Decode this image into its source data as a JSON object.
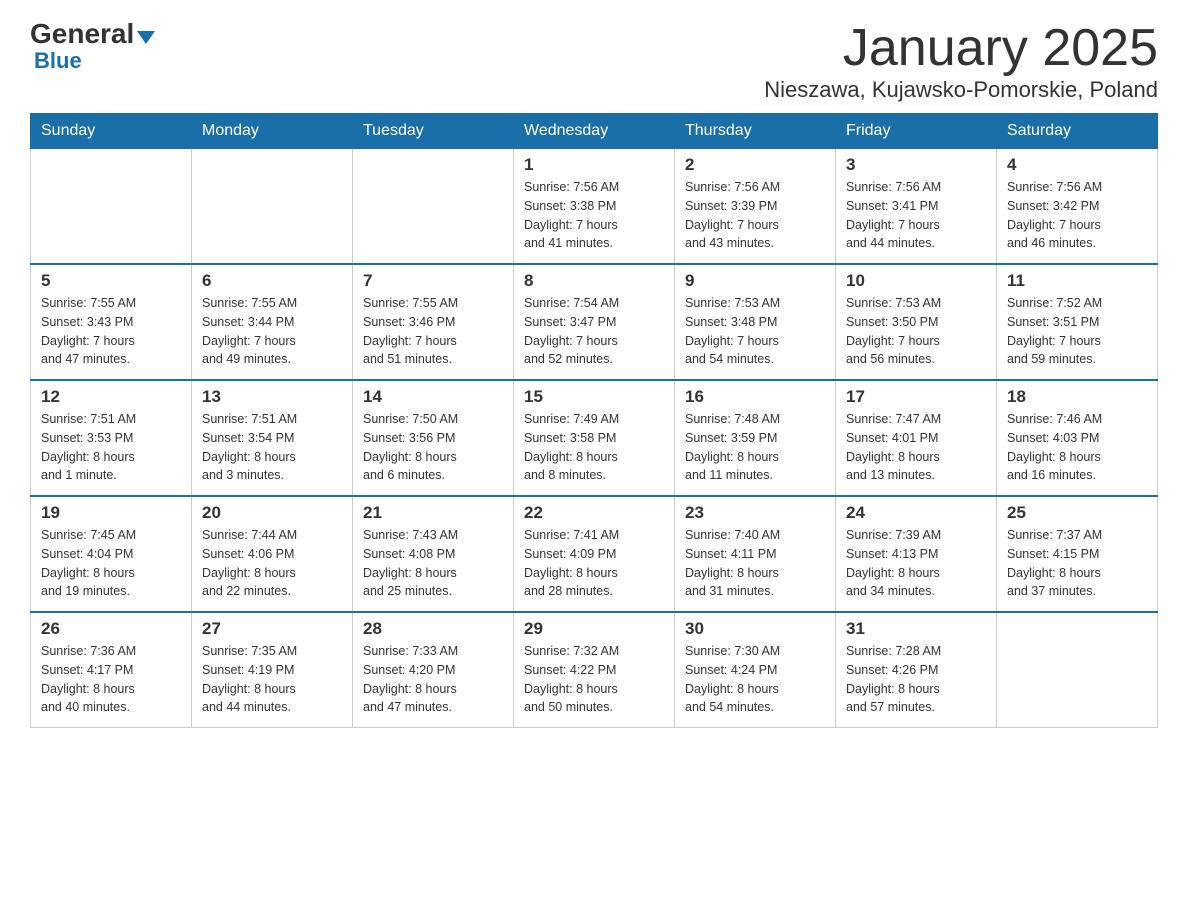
{
  "logo": {
    "general": "General",
    "arrow": "▲",
    "blue": "Blue"
  },
  "header": {
    "month_year": "January 2025",
    "location": "Nieszawa, Kujawsko-Pomorskie, Poland"
  },
  "weekdays": [
    "Sunday",
    "Monday",
    "Tuesday",
    "Wednesday",
    "Thursday",
    "Friday",
    "Saturday"
  ],
  "weeks": [
    [
      {
        "day": "",
        "info": ""
      },
      {
        "day": "",
        "info": ""
      },
      {
        "day": "",
        "info": ""
      },
      {
        "day": "1",
        "info": "Sunrise: 7:56 AM\nSunset: 3:38 PM\nDaylight: 7 hours\nand 41 minutes."
      },
      {
        "day": "2",
        "info": "Sunrise: 7:56 AM\nSunset: 3:39 PM\nDaylight: 7 hours\nand 43 minutes."
      },
      {
        "day": "3",
        "info": "Sunrise: 7:56 AM\nSunset: 3:41 PM\nDaylight: 7 hours\nand 44 minutes."
      },
      {
        "day": "4",
        "info": "Sunrise: 7:56 AM\nSunset: 3:42 PM\nDaylight: 7 hours\nand 46 minutes."
      }
    ],
    [
      {
        "day": "5",
        "info": "Sunrise: 7:55 AM\nSunset: 3:43 PM\nDaylight: 7 hours\nand 47 minutes."
      },
      {
        "day": "6",
        "info": "Sunrise: 7:55 AM\nSunset: 3:44 PM\nDaylight: 7 hours\nand 49 minutes."
      },
      {
        "day": "7",
        "info": "Sunrise: 7:55 AM\nSunset: 3:46 PM\nDaylight: 7 hours\nand 51 minutes."
      },
      {
        "day": "8",
        "info": "Sunrise: 7:54 AM\nSunset: 3:47 PM\nDaylight: 7 hours\nand 52 minutes."
      },
      {
        "day": "9",
        "info": "Sunrise: 7:53 AM\nSunset: 3:48 PM\nDaylight: 7 hours\nand 54 minutes."
      },
      {
        "day": "10",
        "info": "Sunrise: 7:53 AM\nSunset: 3:50 PM\nDaylight: 7 hours\nand 56 minutes."
      },
      {
        "day": "11",
        "info": "Sunrise: 7:52 AM\nSunset: 3:51 PM\nDaylight: 7 hours\nand 59 minutes."
      }
    ],
    [
      {
        "day": "12",
        "info": "Sunrise: 7:51 AM\nSunset: 3:53 PM\nDaylight: 8 hours\nand 1 minute."
      },
      {
        "day": "13",
        "info": "Sunrise: 7:51 AM\nSunset: 3:54 PM\nDaylight: 8 hours\nand 3 minutes."
      },
      {
        "day": "14",
        "info": "Sunrise: 7:50 AM\nSunset: 3:56 PM\nDaylight: 8 hours\nand 6 minutes."
      },
      {
        "day": "15",
        "info": "Sunrise: 7:49 AM\nSunset: 3:58 PM\nDaylight: 8 hours\nand 8 minutes."
      },
      {
        "day": "16",
        "info": "Sunrise: 7:48 AM\nSunset: 3:59 PM\nDaylight: 8 hours\nand 11 minutes."
      },
      {
        "day": "17",
        "info": "Sunrise: 7:47 AM\nSunset: 4:01 PM\nDaylight: 8 hours\nand 13 minutes."
      },
      {
        "day": "18",
        "info": "Sunrise: 7:46 AM\nSunset: 4:03 PM\nDaylight: 8 hours\nand 16 minutes."
      }
    ],
    [
      {
        "day": "19",
        "info": "Sunrise: 7:45 AM\nSunset: 4:04 PM\nDaylight: 8 hours\nand 19 minutes."
      },
      {
        "day": "20",
        "info": "Sunrise: 7:44 AM\nSunset: 4:06 PM\nDaylight: 8 hours\nand 22 minutes."
      },
      {
        "day": "21",
        "info": "Sunrise: 7:43 AM\nSunset: 4:08 PM\nDaylight: 8 hours\nand 25 minutes."
      },
      {
        "day": "22",
        "info": "Sunrise: 7:41 AM\nSunset: 4:09 PM\nDaylight: 8 hours\nand 28 minutes."
      },
      {
        "day": "23",
        "info": "Sunrise: 7:40 AM\nSunset: 4:11 PM\nDaylight: 8 hours\nand 31 minutes."
      },
      {
        "day": "24",
        "info": "Sunrise: 7:39 AM\nSunset: 4:13 PM\nDaylight: 8 hours\nand 34 minutes."
      },
      {
        "day": "25",
        "info": "Sunrise: 7:37 AM\nSunset: 4:15 PM\nDaylight: 8 hours\nand 37 minutes."
      }
    ],
    [
      {
        "day": "26",
        "info": "Sunrise: 7:36 AM\nSunset: 4:17 PM\nDaylight: 8 hours\nand 40 minutes."
      },
      {
        "day": "27",
        "info": "Sunrise: 7:35 AM\nSunset: 4:19 PM\nDaylight: 8 hours\nand 44 minutes."
      },
      {
        "day": "28",
        "info": "Sunrise: 7:33 AM\nSunset: 4:20 PM\nDaylight: 8 hours\nand 47 minutes."
      },
      {
        "day": "29",
        "info": "Sunrise: 7:32 AM\nSunset: 4:22 PM\nDaylight: 8 hours\nand 50 minutes."
      },
      {
        "day": "30",
        "info": "Sunrise: 7:30 AM\nSunset: 4:24 PM\nDaylight: 8 hours\nand 54 minutes."
      },
      {
        "day": "31",
        "info": "Sunrise: 7:28 AM\nSunset: 4:26 PM\nDaylight: 8 hours\nand 57 minutes."
      },
      {
        "day": "",
        "info": ""
      }
    ]
  ]
}
